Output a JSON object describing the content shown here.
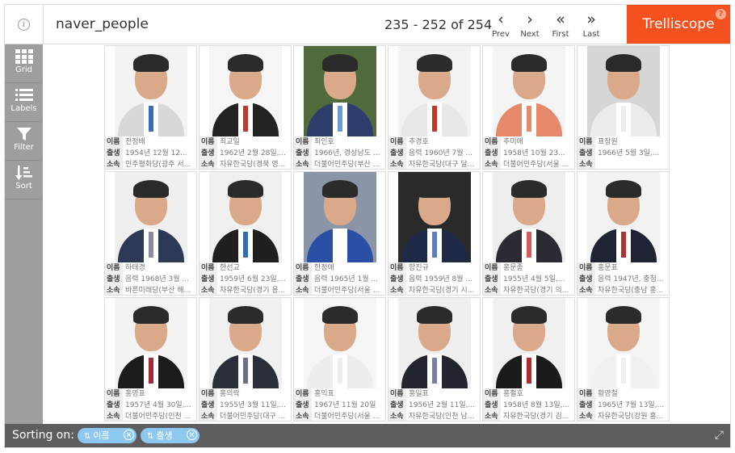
{
  "header": {
    "info_icon": "info-icon",
    "title": "naver_people",
    "range": "235 - 252 of 254",
    "nav": [
      {
        "glyph": "‹",
        "label": "Prev"
      },
      {
        "glyph": "›",
        "label": "Next"
      },
      {
        "glyph": "«",
        "label": "First"
      },
      {
        "glyph": "»",
        "label": "Last"
      }
    ],
    "brand": "Trelliscope",
    "help": "?"
  },
  "sidebar": {
    "items": [
      {
        "label": "Grid",
        "icon": "grid-icon"
      },
      {
        "label": "Labels",
        "icon": "labels-icon"
      },
      {
        "label": "Filter",
        "icon": "filter-icon"
      },
      {
        "label": "Sort",
        "icon": "sort-icon"
      }
    ]
  },
  "label_keys": [
    "이름",
    "출생",
    "소속"
  ],
  "panels": [
    {
      "name": "천정배",
      "birth": "1954년 12월 12...",
      "party": "민주평화당(광주 서..."
    },
    {
      "name": "최교일",
      "birth": "1962년 2월 28일,...",
      "party": "자유한국당(경북 영..."
    },
    {
      "name": "최인호",
      "birth": "1966년, 경상남도 ...",
      "party": "더불어민주당(부산 ..."
    },
    {
      "name": "추경호",
      "birth": "음력 1960년 7월 ...",
      "party": "자유한국당(대구 달..."
    },
    {
      "name": "추미애",
      "birth": "1958년 10월 23...",
      "party": "더불어민주당(서울 ..."
    },
    {
      "name": "표창원",
      "birth": "1966년 5월 3일,...",
      "party": ""
    },
    {
      "name": "하태경",
      "birth": "음력 1968년 3월 ...",
      "party": "바른미래당(부산 해..."
    },
    {
      "name": "한선교",
      "birth": "1959년 6월 23일,...",
      "party": "자유한국당(경기 용..."
    },
    {
      "name": "한정애",
      "birth": "음력 1965년 1월 ...",
      "party": "더불어민주당(서울 ..."
    },
    {
      "name": "함진규",
      "birth": "음력 1959년 8월 ...",
      "party": "자유한국당(경기 시..."
    },
    {
      "name": "홍문종",
      "birth": "1955년 4월 5일,...",
      "party": "자유한국당(경기 의..."
    },
    {
      "name": "홍문표",
      "birth": "음력 1947년, 충청...",
      "party": "자유한국당(충남 홍..."
    },
    {
      "name": "홍영표",
      "birth": "1957년 4월 30일,...",
      "party": "더불어민주당(인천 ..."
    },
    {
      "name": "홍의락",
      "birth": "1955년 3월 11일,...",
      "party": "더불어민주당(대구 ..."
    },
    {
      "name": "홍익표",
      "birth": "1967년 11월 20일",
      "party": "더불어민주당(서울 ..."
    },
    {
      "name": "홍일표",
      "birth": "1956년 2월 11일,...",
      "party": "자유한국당(인천 남..."
    },
    {
      "name": "홍철호",
      "birth": "1958년 8월 13일,...",
      "party": "자유한국당(경기 김..."
    },
    {
      "name": "황영철",
      "birth": "1965년 7월 13일,...",
      "party": "자유한국당(강원 홍..."
    }
  ],
  "photo_styles": [
    {
      "bg": "#f3f3f3",
      "suit": "#d8d8d8",
      "tie": "#3b6fb5"
    },
    {
      "bg": "#f5f5f5",
      "suit": "#222222",
      "tie": "#c0392b"
    },
    {
      "bg": "#4f6b3c",
      "suit": "#2e3d6b",
      "tie": "#6a9bd8"
    },
    {
      "bg": "#f2f2f2",
      "suit": "#e8e8e8",
      "tie": "#c0392b"
    },
    {
      "bg": "#f4f4f4",
      "suit": "#e6886a",
      "tie": "#e6886a"
    },
    {
      "bg": "#d6d6d6",
      "suit": "#ececec",
      "tie": "#ececec"
    },
    {
      "bg": "#efefef",
      "suit": "#2c3a55",
      "tie": "#8a8aa0"
    },
    {
      "bg": "#f0f0f0",
      "suit": "#1f1f1f",
      "tie": "#2f6db5"
    },
    {
      "bg": "#8a96a8",
      "suit": "#2a4fa5",
      "tie": "#ffffff"
    },
    {
      "bg": "#2a2a2a",
      "suit": "#1e2a45",
      "tie": "#5c7fbf"
    },
    {
      "bg": "#eeeeee",
      "suit": "#2b2b33",
      "tie": "#d85a5a"
    },
    {
      "bg": "#f2f2f2",
      "suit": "#1f2233",
      "tie": "#b23030"
    },
    {
      "bg": "#f3f3f3",
      "suit": "#1c1c1c",
      "tie": "#a02a3a"
    },
    {
      "bg": "#f0f0f0",
      "suit": "#2a2f3a",
      "tie": "#6a6f8a"
    },
    {
      "bg": "#f5f5f5",
      "suit": "#ededed",
      "tie": "#ededed"
    },
    {
      "bg": "#efefef",
      "suit": "#22242e",
      "tie": "#7a7fa8"
    },
    {
      "bg": "#f0f0f0",
      "suit": "#1b1b1b",
      "tie": "#b22a2a"
    },
    {
      "bg": "#f4f4f4",
      "suit": "#f0f0f0",
      "tie": "#f0f0f0"
    }
  ],
  "footer": {
    "label": "Sorting on:",
    "chips": [
      {
        "label": "이름",
        "icon": "sort-asc-icon"
      },
      {
        "label": "출생",
        "icon": "sort-asc-icon"
      }
    ],
    "expand_icon": "expand-icon"
  },
  "colors": {
    "accent": "#f4511e",
    "sidebar": "#9e9e9e",
    "footer": "#5e5e5e",
    "chip": "#8ec7f0"
  }
}
